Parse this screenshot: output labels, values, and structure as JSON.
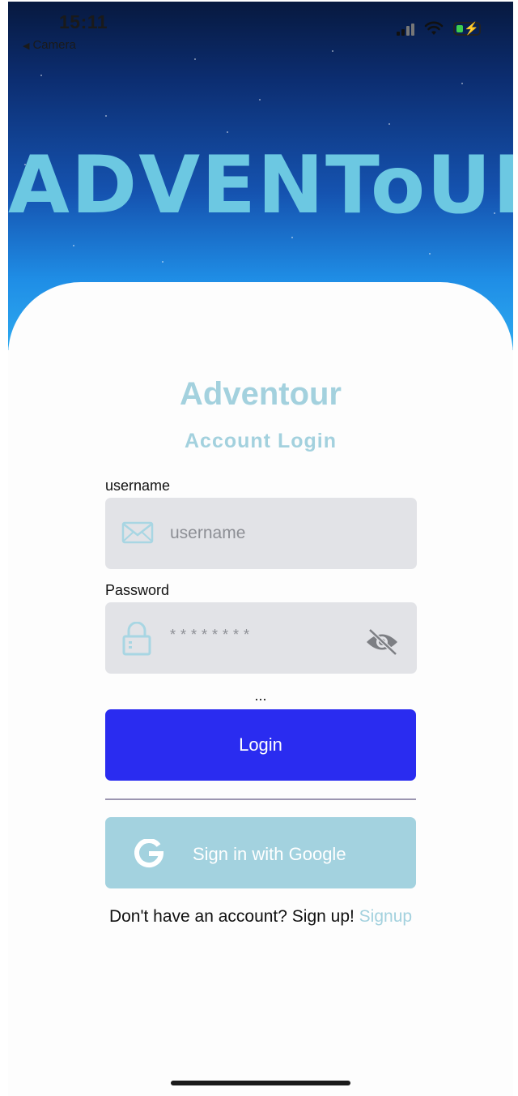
{
  "status_bar": {
    "time": "15:11",
    "back_app": "Camera"
  },
  "hero": {
    "logo_text": "ADVENToUR"
  },
  "card": {
    "title": "Adventour",
    "subtitle": "Account Login"
  },
  "form": {
    "username_label": "username",
    "username_placeholder": "username",
    "password_label": "Password",
    "password_placeholder": "********",
    "forgot_ellipsis": "...",
    "login_button": "Login",
    "google_button": "Sign in with Google",
    "signup_prompt": "Don't have an account? Sign up!",
    "signup_link": "Signup"
  },
  "icons": {
    "username_field": "envelope-icon",
    "password_field": "lock-icon",
    "password_toggle": "eye-slash-icon",
    "google": "google-g-icon"
  },
  "colors": {
    "accent_light_blue": "#a3d1de",
    "login_button": "#2a2cf0",
    "google_button": "#a3d2df",
    "field_background": "#e2e3e7",
    "logo": "#6cc8e2"
  }
}
